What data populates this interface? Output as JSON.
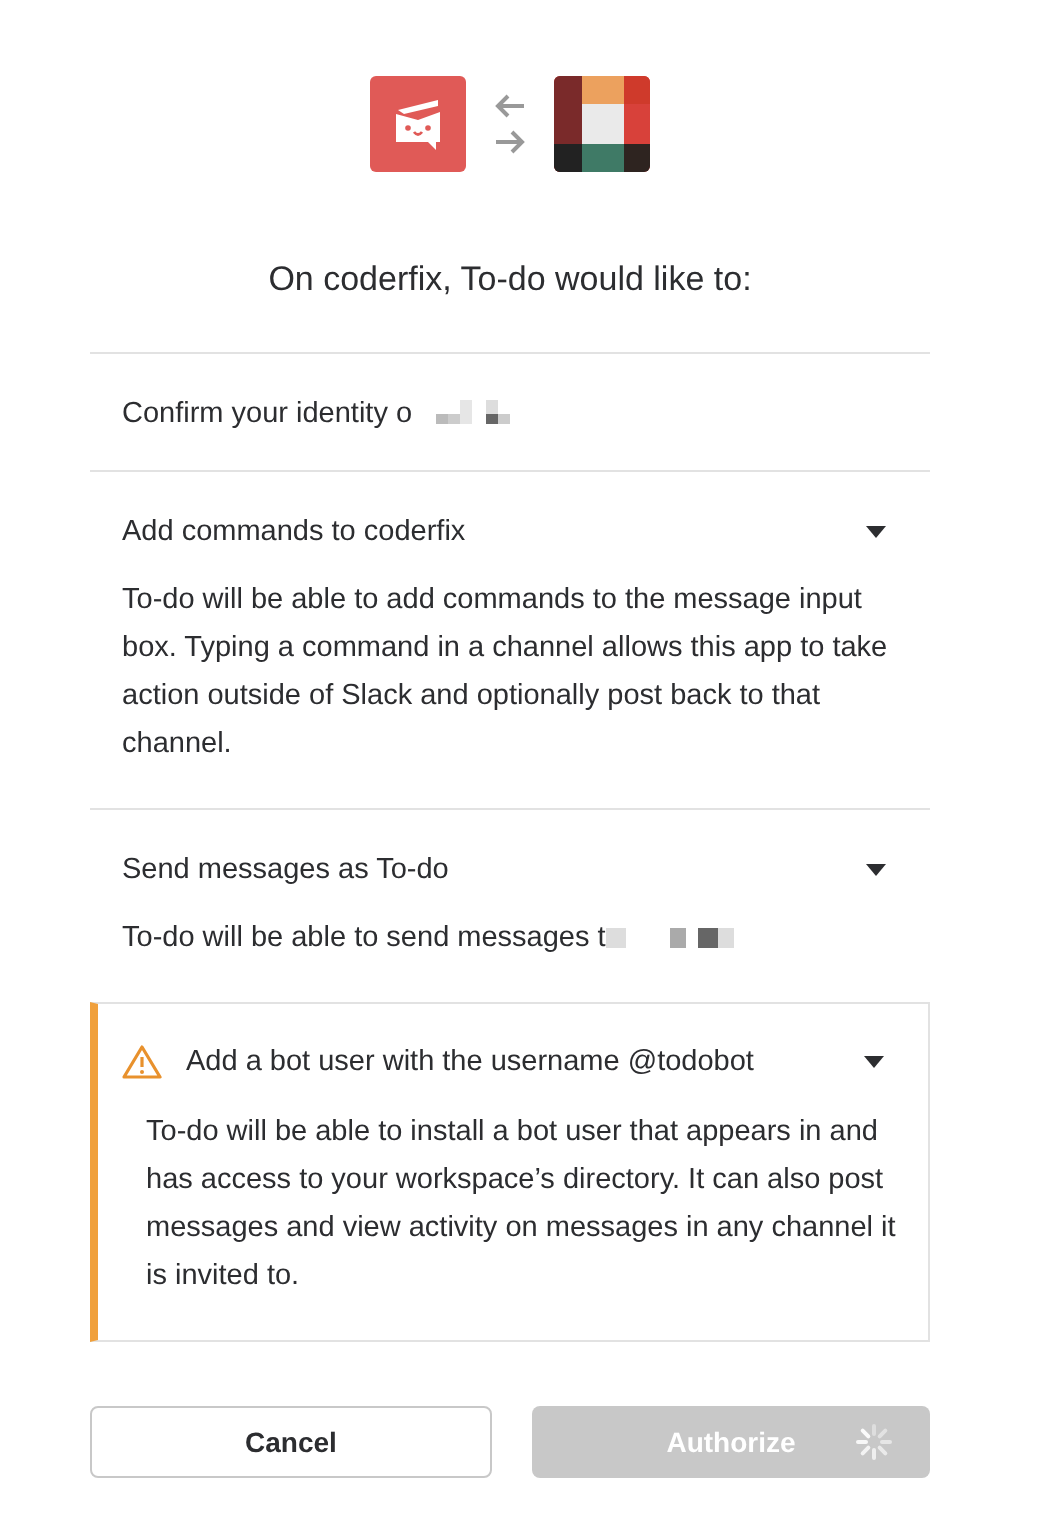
{
  "heading": "On coderfix, To-do would like to:",
  "sections": [
    {
      "kind": "plain",
      "title": "Confirm your identity o",
      "redacted": true,
      "expandable": false
    },
    {
      "kind": "plain",
      "title": "Add commands to coderfix",
      "expandable": true,
      "description": "To-do will be able to add commands to the message input box. Typing a command in a channel allows this app to take action outside of Slack and optionally post back to that channel."
    },
    {
      "kind": "plain",
      "title": "Send messages as To-do",
      "expandable": true,
      "description": "To-do will be able to send messages t",
      "description_redacted": true
    },
    {
      "kind": "warning",
      "title": "Add a bot user with the username @todobot",
      "expandable": true,
      "description": "To-do will be able to install a bot user that appears in and has access to your workspace’s directory. It can also post messages and view activity on messages in any channel it is invited to."
    }
  ],
  "buttons": [
    {
      "label": "Cancel",
      "kind": "secondary"
    },
    {
      "label": "Authorize",
      "kind": "primary",
      "disabled": true,
      "loading": true
    }
  ]
}
